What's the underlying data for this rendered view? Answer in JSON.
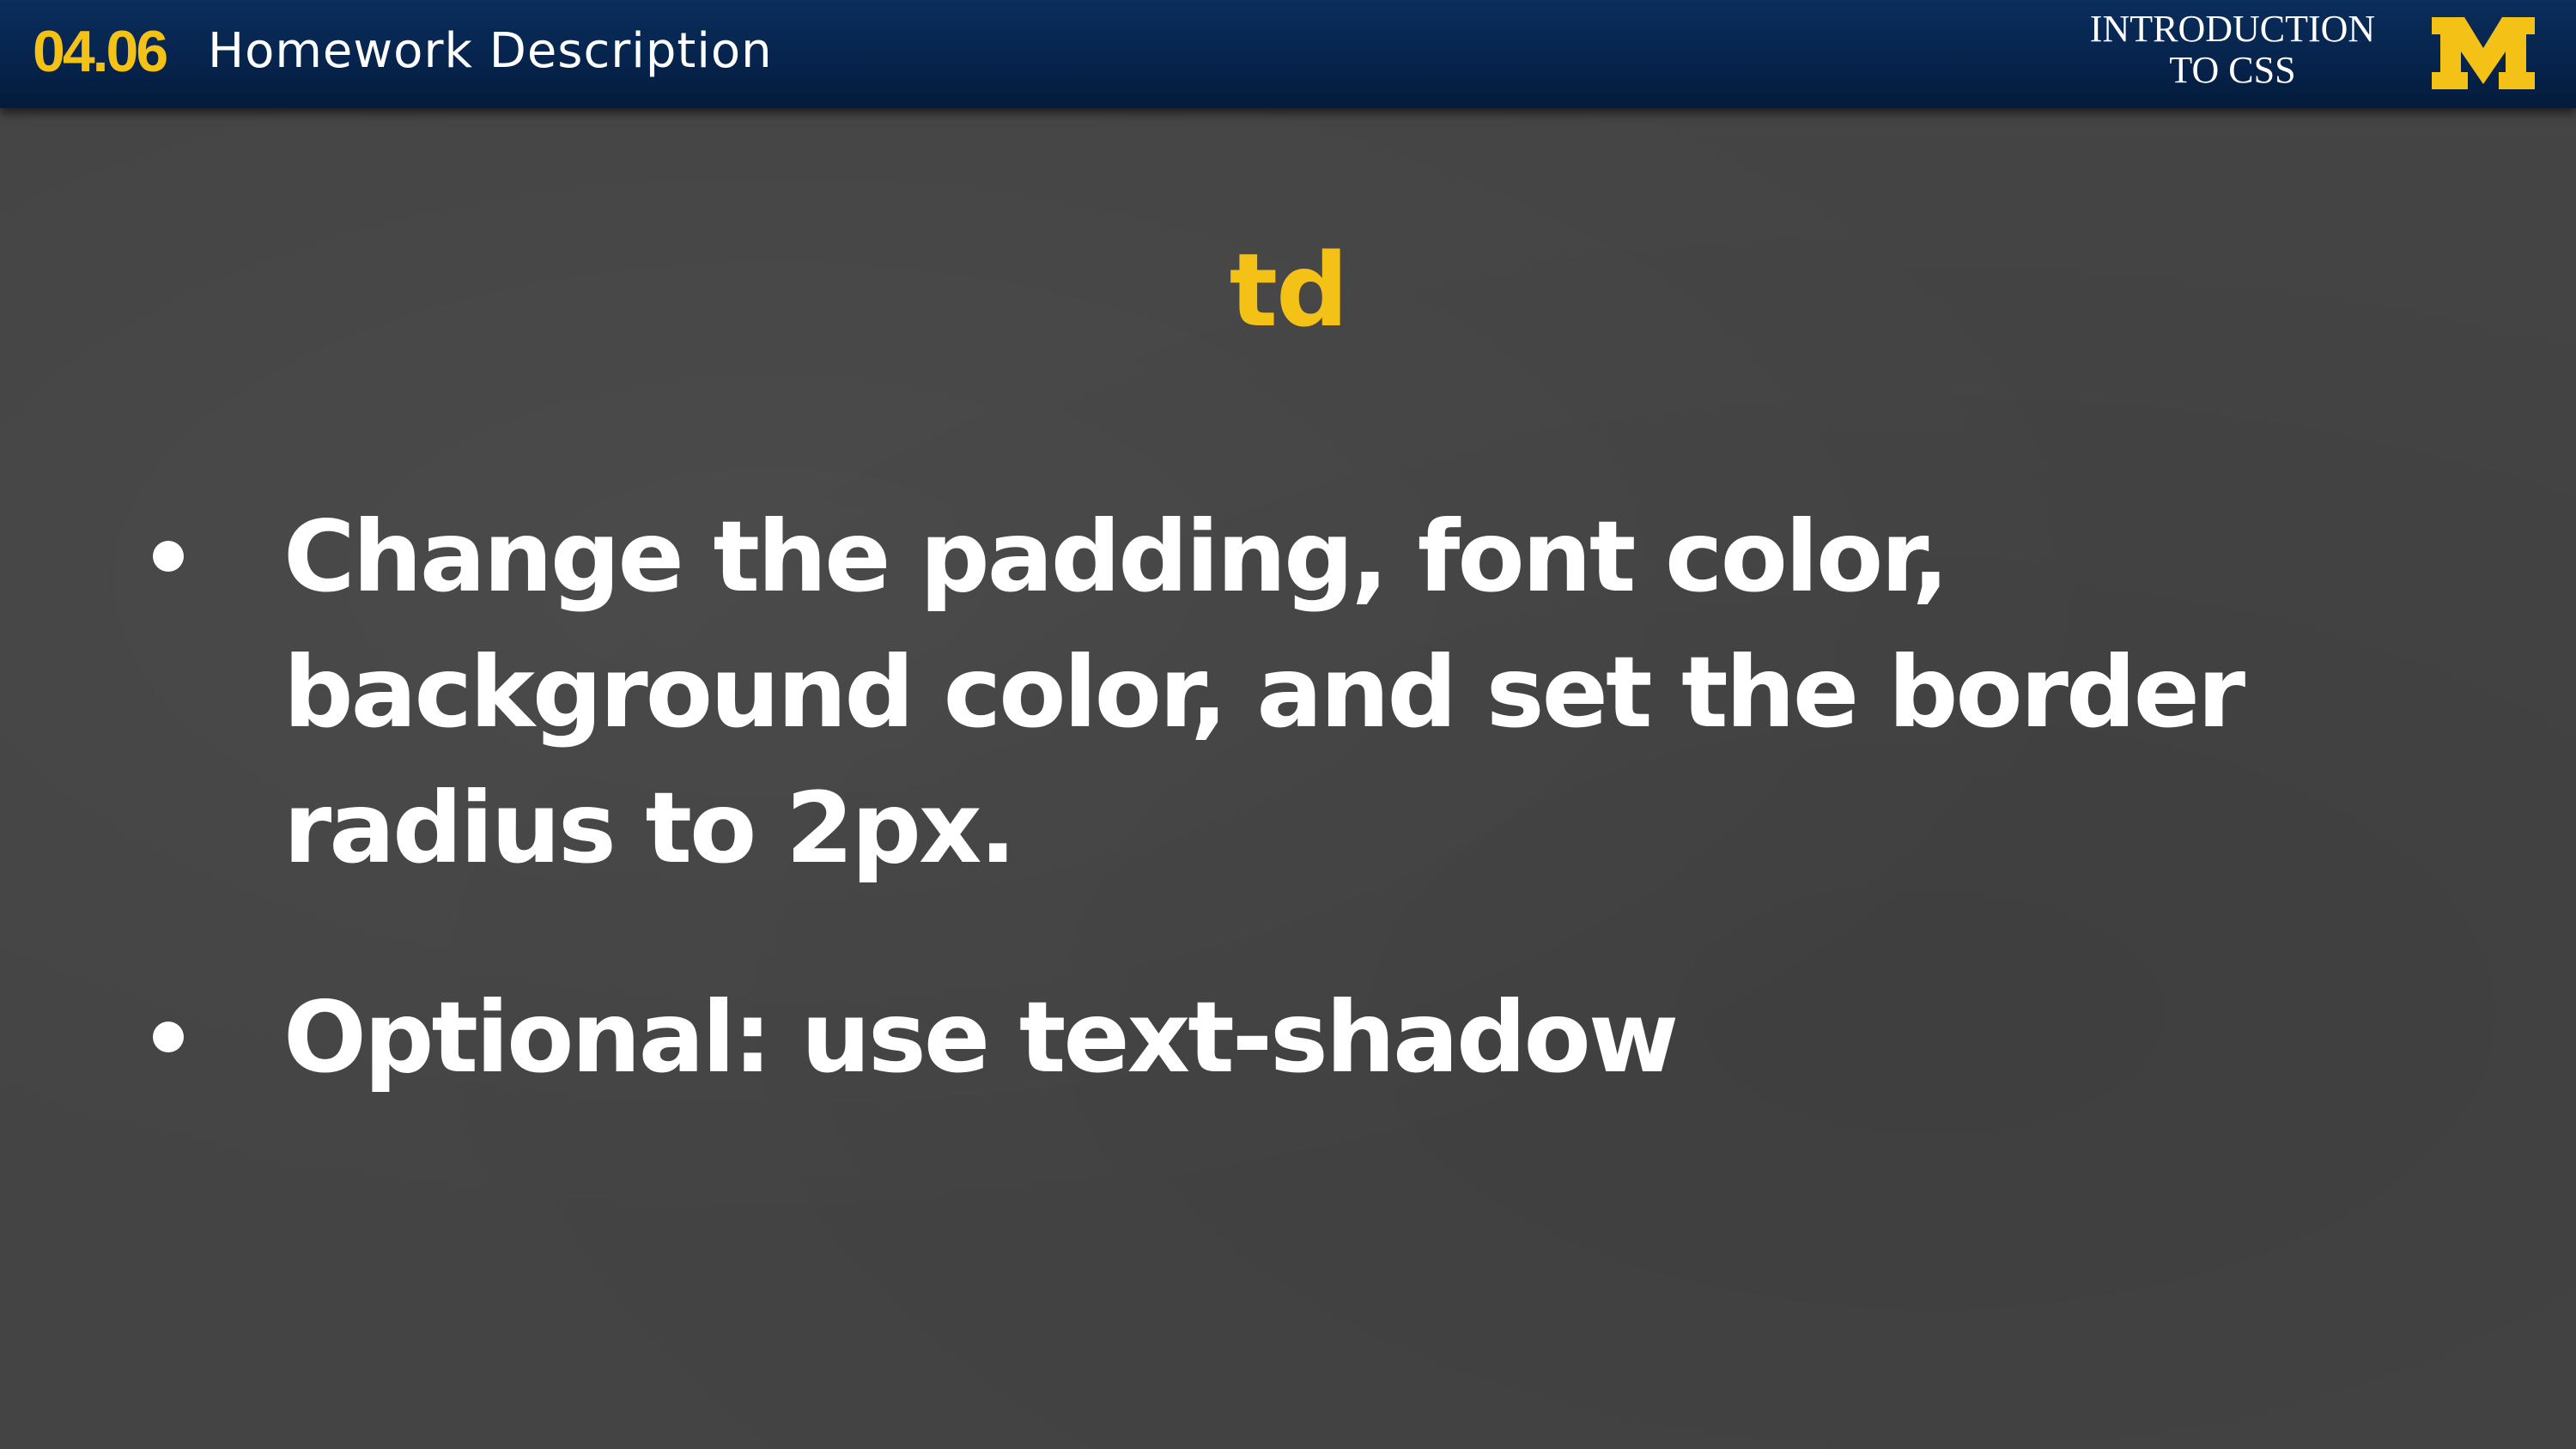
{
  "header": {
    "lesson_number": "04.06",
    "lesson_title": "Homework Description",
    "course_title": "INTRODUCTION\nTO CSS",
    "logo_icon": "block-m-logo",
    "logo_color": "#f4c116",
    "bar_color": "#06244d"
  },
  "slide": {
    "heading": "td",
    "heading_color": "#f4c116",
    "bullets": [
      "Change the padding, font color, background color, and set the border radius to 2px.",
      "Optional: use text-shadow"
    ]
  }
}
